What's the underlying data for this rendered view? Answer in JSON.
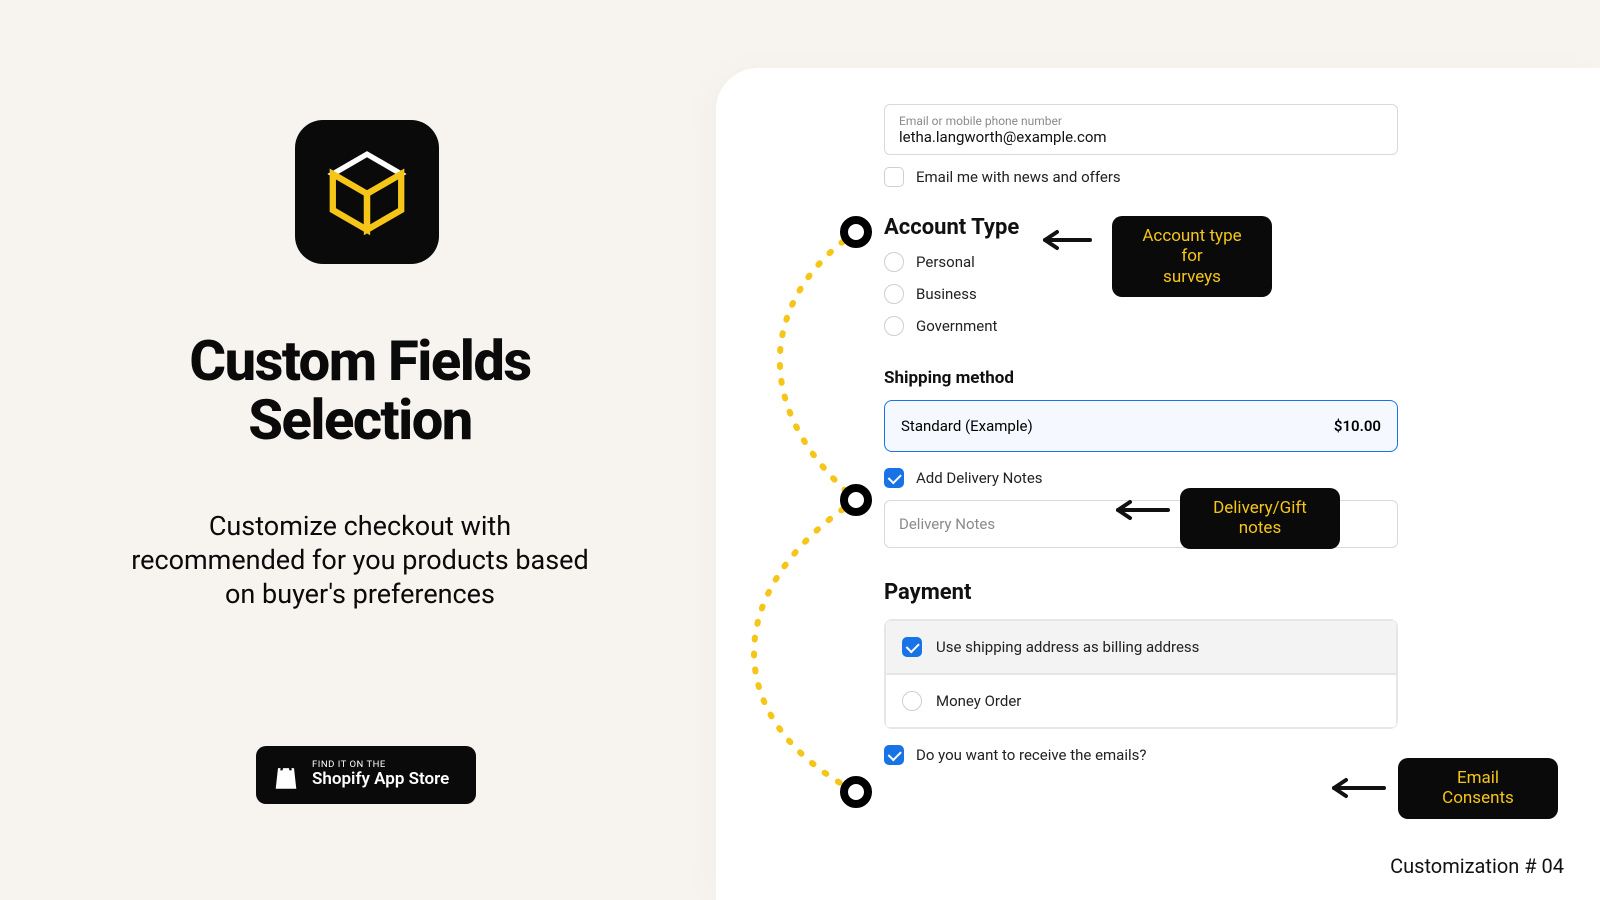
{
  "left": {
    "headline_l1": "Custom Fields",
    "headline_l2": "Selection",
    "subhead": "Customize checkout with recommended for you products based on buyer's preferences",
    "badge_pre": "FIND IT ON THE",
    "badge_main": "Shopify App Store"
  },
  "form": {
    "email_label": "Email or mobile phone number",
    "email_value": "letha.langworth@example.com",
    "news_label": "Email me with news and offers",
    "account_heading": "Account Type",
    "account_options": {
      "0": "Personal",
      "1": "Business",
      "2": "Government"
    },
    "shipping_heading": "Shipping method",
    "shipping_name": "Standard (Example)",
    "shipping_price": "$10.00",
    "delivery_cb": "Add Delivery Notes",
    "delivery_ph": "Delivery Notes",
    "payment_heading": "Payment",
    "billing_same": "Use shipping address as billing address",
    "money_order": "Money Order",
    "emails_consent": "Do you want to receive the emails?"
  },
  "callouts": {
    "c1_l1": "Account type for",
    "c1_l2": "surveys",
    "c2_l1": "Delivery/Gift",
    "c2_l2": "notes",
    "c3_l1": "Email",
    "c3_l2": "Consents"
  },
  "caption": "Customization # 04"
}
